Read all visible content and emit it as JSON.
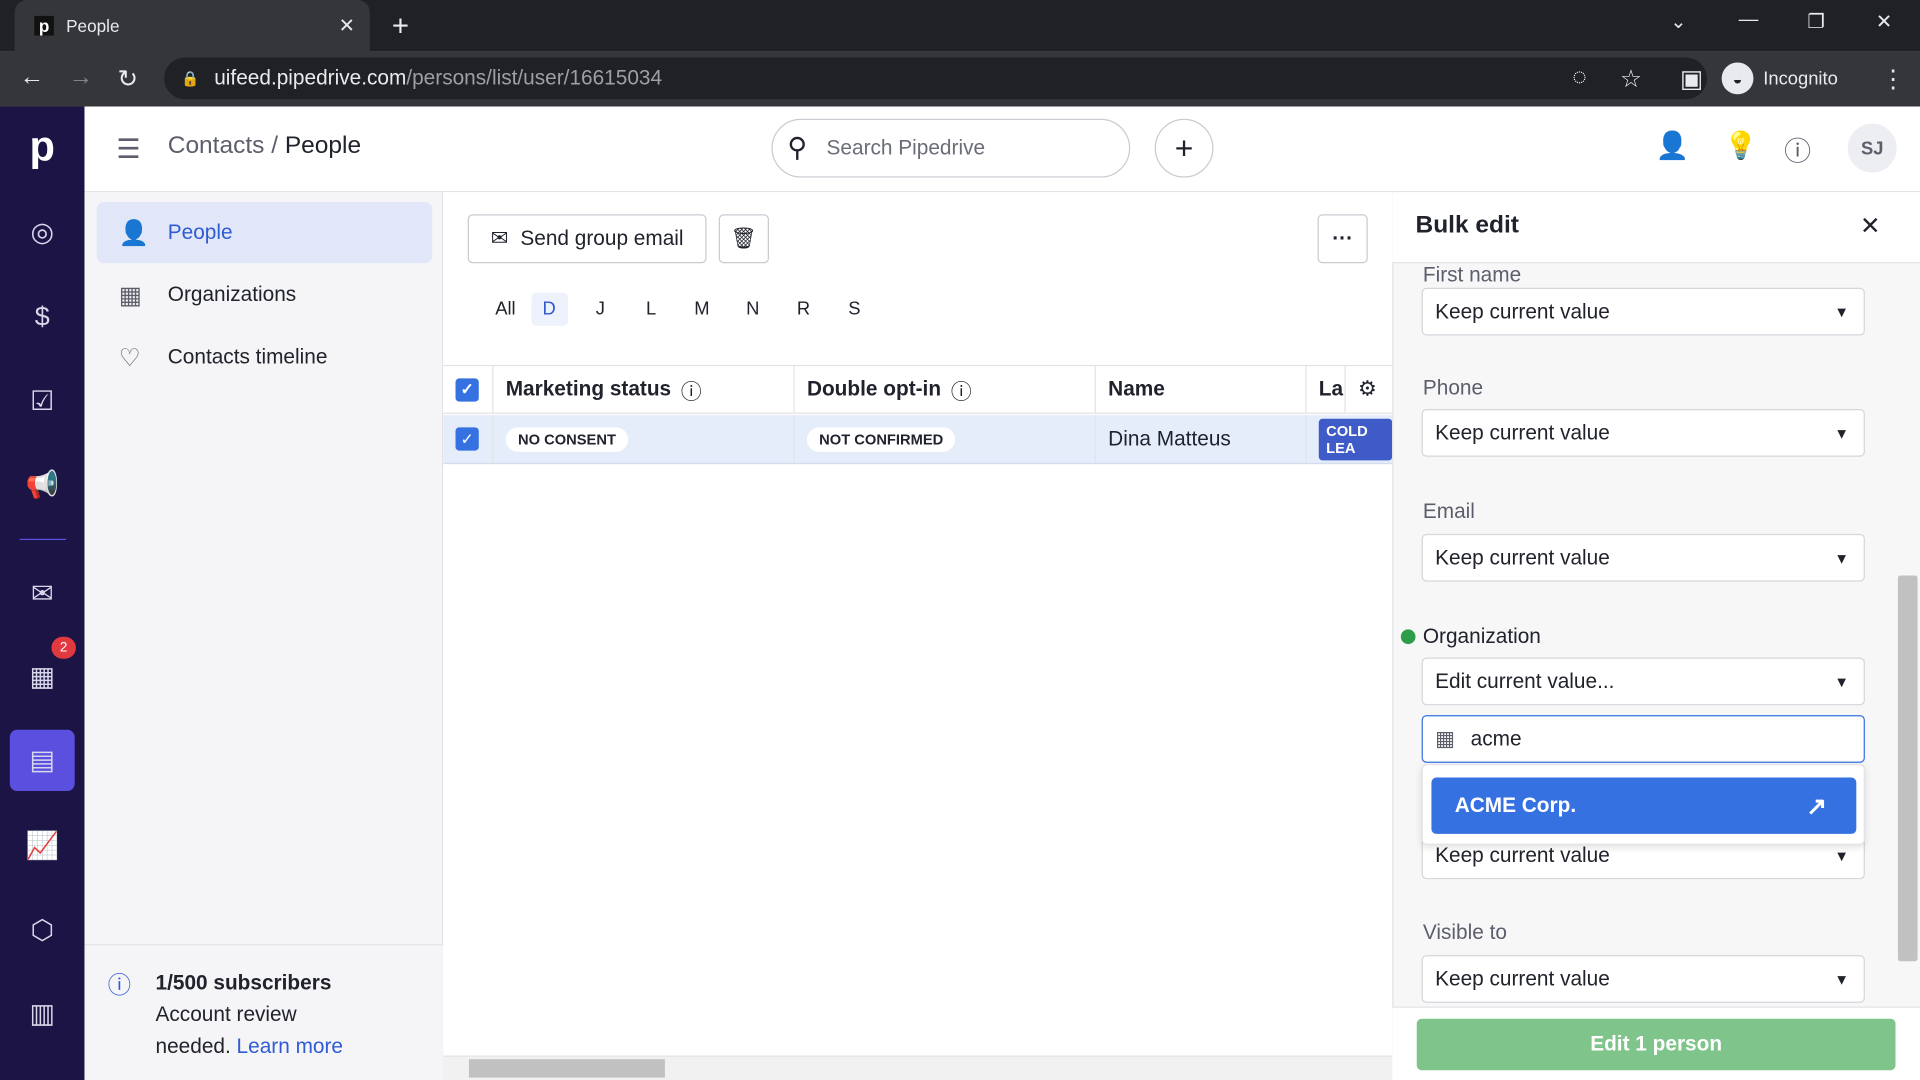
{
  "browser": {
    "tab_title": "People",
    "url_host": "uifeed.pipedrive.com",
    "url_path": "/persons/list/user/16615034",
    "incognito_label": "Incognito"
  },
  "header": {
    "breadcrumb_parent": "Contacts",
    "breadcrumb_current": "People",
    "search_placeholder": "Search Pipedrive",
    "avatar_initials": "SJ"
  },
  "app_nav": {
    "logo": "p",
    "activity_badge": "2"
  },
  "sidebar": {
    "items": [
      {
        "label": "People",
        "icon": "person-icon"
      },
      {
        "label": "Organizations",
        "icon": "building-icon"
      },
      {
        "label": "Contacts timeline",
        "icon": "heart-pulse-icon"
      }
    ],
    "subscribers": "1/500 subscribers",
    "review": "Account review",
    "needed": "needed.",
    "learn_more": "Learn more"
  },
  "toolbar": {
    "send_group_email": "Send group email",
    "more": "···"
  },
  "letters": [
    "All",
    "D",
    "J",
    "L",
    "M",
    "N",
    "R",
    "S"
  ],
  "active_letter": "D",
  "table": {
    "columns": [
      "Marketing status",
      "Double opt-in",
      "Name",
      "La"
    ],
    "rows": [
      {
        "marketing_status": "NO CONSENT",
        "double_opt_in": "NOT CONFIRMED",
        "name": "Dina Matteus",
        "label": "COLD LEA"
      }
    ]
  },
  "bulk_edit": {
    "title": "Bulk edit",
    "first_name_label": "First name",
    "first_name": "Keep current value",
    "phone_label": "Phone",
    "phone": "Keep current value",
    "email_label": "Email",
    "email": "Keep current value",
    "org_label": "Organization",
    "org": "Edit current value...",
    "org_search": "acme",
    "org_option": "ACME Corp.",
    "hidden_field": "Keep current value",
    "visible_label": "Visible to",
    "visible": "Keep current value",
    "submit": "Edit 1 person"
  },
  "colors": {
    "nav": "#1b1444",
    "accent": "#3571e1",
    "submit": "#7fc48b",
    "changed_dot": "#2e9d49"
  }
}
